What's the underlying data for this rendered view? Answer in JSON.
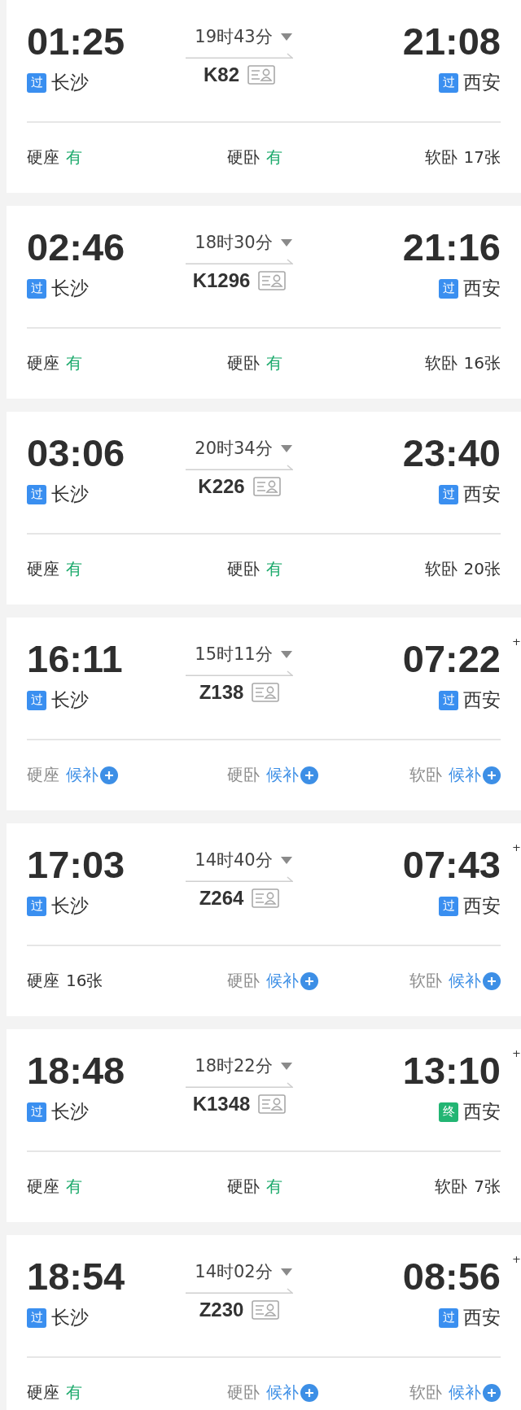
{
  "trains": [
    {
      "depart": "01:25",
      "depart_station": {
        "badge": "过",
        "kind": "pass",
        "name": "长沙"
      },
      "duration": "19时43分",
      "number": "K82",
      "arrive": "21:08",
      "arrive_station": {
        "badge": "过",
        "kind": "pass",
        "name": "西安"
      },
      "seats": [
        {
          "label": "硬座",
          "kind": "available",
          "status": "有"
        },
        {
          "label": "硬卧",
          "kind": "available",
          "status": "有"
        },
        {
          "label": "软卧",
          "kind": "count",
          "status": "17张"
        }
      ]
    },
    {
      "depart": "02:46",
      "depart_station": {
        "badge": "过",
        "kind": "pass",
        "name": "长沙"
      },
      "duration": "18时30分",
      "number": "K1296",
      "arrive": "21:16",
      "arrive_station": {
        "badge": "过",
        "kind": "pass",
        "name": "西安"
      },
      "seats": [
        {
          "label": "硬座",
          "kind": "available",
          "status": "有"
        },
        {
          "label": "硬卧",
          "kind": "available",
          "status": "有"
        },
        {
          "label": "软卧",
          "kind": "count",
          "status": "16张"
        }
      ]
    },
    {
      "depart": "03:06",
      "depart_station": {
        "badge": "过",
        "kind": "pass",
        "name": "长沙"
      },
      "duration": "20时34分",
      "number": "K226",
      "arrive": "23:40",
      "arrive_station": {
        "badge": "过",
        "kind": "pass",
        "name": "西安"
      },
      "seats": [
        {
          "label": "硬座",
          "kind": "available",
          "status": "有"
        },
        {
          "label": "硬卧",
          "kind": "available",
          "status": "有"
        },
        {
          "label": "软卧",
          "kind": "count",
          "status": "20张"
        }
      ]
    },
    {
      "depart": "16:11",
      "depart_station": {
        "badge": "过",
        "kind": "pass",
        "name": "长沙"
      },
      "duration": "15时11分",
      "number": "Z138",
      "arrive": "07:22",
      "day_mark": "+",
      "arrive_station": {
        "badge": "过",
        "kind": "pass",
        "name": "西安"
      },
      "seats": [
        {
          "label": "硬座",
          "kind": "waitlist",
          "status": "候补"
        },
        {
          "label": "硬卧",
          "kind": "waitlist",
          "status": "候补"
        },
        {
          "label": "软卧",
          "kind": "waitlist",
          "status": "候补"
        }
      ]
    },
    {
      "depart": "17:03",
      "depart_station": {
        "badge": "过",
        "kind": "pass",
        "name": "长沙"
      },
      "duration": "14时40分",
      "number": "Z264",
      "arrive": "07:43",
      "day_mark": "+",
      "arrive_station": {
        "badge": "过",
        "kind": "pass",
        "name": "西安"
      },
      "seats": [
        {
          "label": "硬座",
          "kind": "count",
          "status": "16张"
        },
        {
          "label": "硬卧",
          "kind": "waitlist",
          "status": "候补"
        },
        {
          "label": "软卧",
          "kind": "waitlist",
          "status": "候补"
        }
      ]
    },
    {
      "depart": "18:48",
      "depart_station": {
        "badge": "过",
        "kind": "pass",
        "name": "长沙"
      },
      "duration": "18时22分",
      "number": "K1348",
      "arrive": "13:10",
      "day_mark": "+",
      "arrive_station": {
        "badge": "终",
        "kind": "end",
        "name": "西安"
      },
      "seats": [
        {
          "label": "硬座",
          "kind": "available",
          "status": "有"
        },
        {
          "label": "硬卧",
          "kind": "available",
          "status": "有"
        },
        {
          "label": "软卧",
          "kind": "count",
          "status": "7张"
        }
      ]
    },
    {
      "depart": "18:54",
      "depart_station": {
        "badge": "过",
        "kind": "pass",
        "name": "长沙"
      },
      "duration": "14时02分",
      "number": "Z230",
      "arrive": "08:56",
      "day_mark": "+",
      "arrive_station": {
        "badge": "过",
        "kind": "pass",
        "name": "西安"
      },
      "seats": [
        {
          "label": "硬座",
          "kind": "available",
          "status": "有"
        },
        {
          "label": "硬卧",
          "kind": "waitlist",
          "status": "候补"
        },
        {
          "label": "软卧",
          "kind": "waitlist",
          "status": "候补"
        }
      ]
    }
  ]
}
